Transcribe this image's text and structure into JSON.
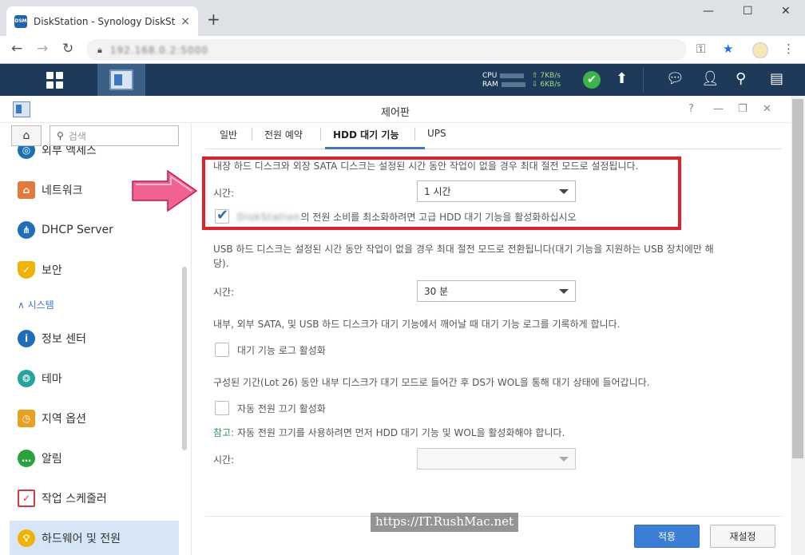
{
  "browser": {
    "tab_title": "DiskStation - Synology DiskStation",
    "favicon_text": "DSM",
    "close_tab": "×",
    "new_tab": "+",
    "minimize": "—",
    "maximize": "☐",
    "close_window": "✕",
    "url": "192.168.0.2:5000"
  },
  "taskbar": {
    "cpu_label": "CPU",
    "ram_label": "RAM",
    "upload": "⇧ 7KB/s",
    "download": "⇩ 6KB/s"
  },
  "window": {
    "title": "제어판",
    "help": "?",
    "minimize": "—",
    "restore": "❐",
    "close": "✕"
  },
  "sidebar": {
    "search_placeholder": "검색",
    "items": [
      {
        "label": "외부 액세스",
        "icon": "external-access-icon",
        "color": "#1e6fb8"
      },
      {
        "label": "네트워크",
        "icon": "network-icon",
        "color": "#e27a3b"
      },
      {
        "label": "DHCP Server",
        "icon": "dhcp-server-icon",
        "color": "#1e6fb8"
      },
      {
        "label": "보안",
        "icon": "security-shield-icon",
        "color": "#f0b400"
      },
      {
        "label": "정보 센터",
        "icon": "info-center-icon",
        "color": "#1e6fb8"
      },
      {
        "label": "테마",
        "icon": "theme-palette-icon",
        "color": "#23a4a0"
      },
      {
        "label": "지역 옵션",
        "icon": "regional-options-icon",
        "color": "#e8a020"
      },
      {
        "label": "알림",
        "icon": "notification-icon",
        "color": "#2ba33a"
      },
      {
        "label": "작업 스케줄러",
        "icon": "task-scheduler-icon",
        "color": "#d33a3a"
      },
      {
        "label": "하드웨어 및 전원",
        "icon": "hardware-power-icon",
        "color": "#f0b400"
      }
    ],
    "group_system": "∧  시스템"
  },
  "main": {
    "tabs": [
      "일반",
      "전원 예약",
      "HDD 대기 기능",
      "UPS"
    ],
    "active_tab": "HDD 대기 기능",
    "internal_desc": "내장 하드 디스크와 외장 SATA 디스크는 설정된 시간 동안 작업이 없을 경우 최대 절전 모드로 설정됩니다.",
    "time_label": "시간:",
    "internal_time": "1 시간",
    "hdd_checkbox_name": "DiskStation",
    "hdd_checkbox_text": "의 전원 소비를 최소화하려면 고급 HDD 대기 기능을 활성화하십시오",
    "usb_desc_line1": "USB 하드 디스크는 설정된 시간 동안 작업이 없을 경우 최대 절전 모드로 전환됩니다(대기 기능을 지원하는 USB 장치에만 해",
    "usb_desc_line2": "당).",
    "usb_time": "30 분",
    "log_desc": "내부, 외부 SATA, 및 USB 하드 디스크가 대기 기능에서 깨어날 때 대기 기능 로그를 기록하게 합니다.",
    "log_checkbox": "대기 기능 로그 활성화",
    "autopower_desc": "구성된 기간(Lot 26) 동안 내부 디스크가 대기 모드로 들어간 후 DS가 WOL을 통해 대기 상태에 들어갑니다.",
    "autopower_checkbox": "자동 전원 끄기 활성화",
    "note_key": "참고:",
    "note_text": " 자동 전원 끄기를 사용하려면 먼저 HDD 대기 기능 및 WOL을 활성화해야 합니다.",
    "autopower_time": "",
    "apply": "적용",
    "reset": "재설정"
  },
  "watermark": "https://IT.RushMac.net",
  "colors": {
    "taskbar": "#1e3a5a",
    "accent": "#3a78c6",
    "highlight_box": "#e0202a",
    "note": "#2b9b61",
    "arrow": "#f06292"
  }
}
